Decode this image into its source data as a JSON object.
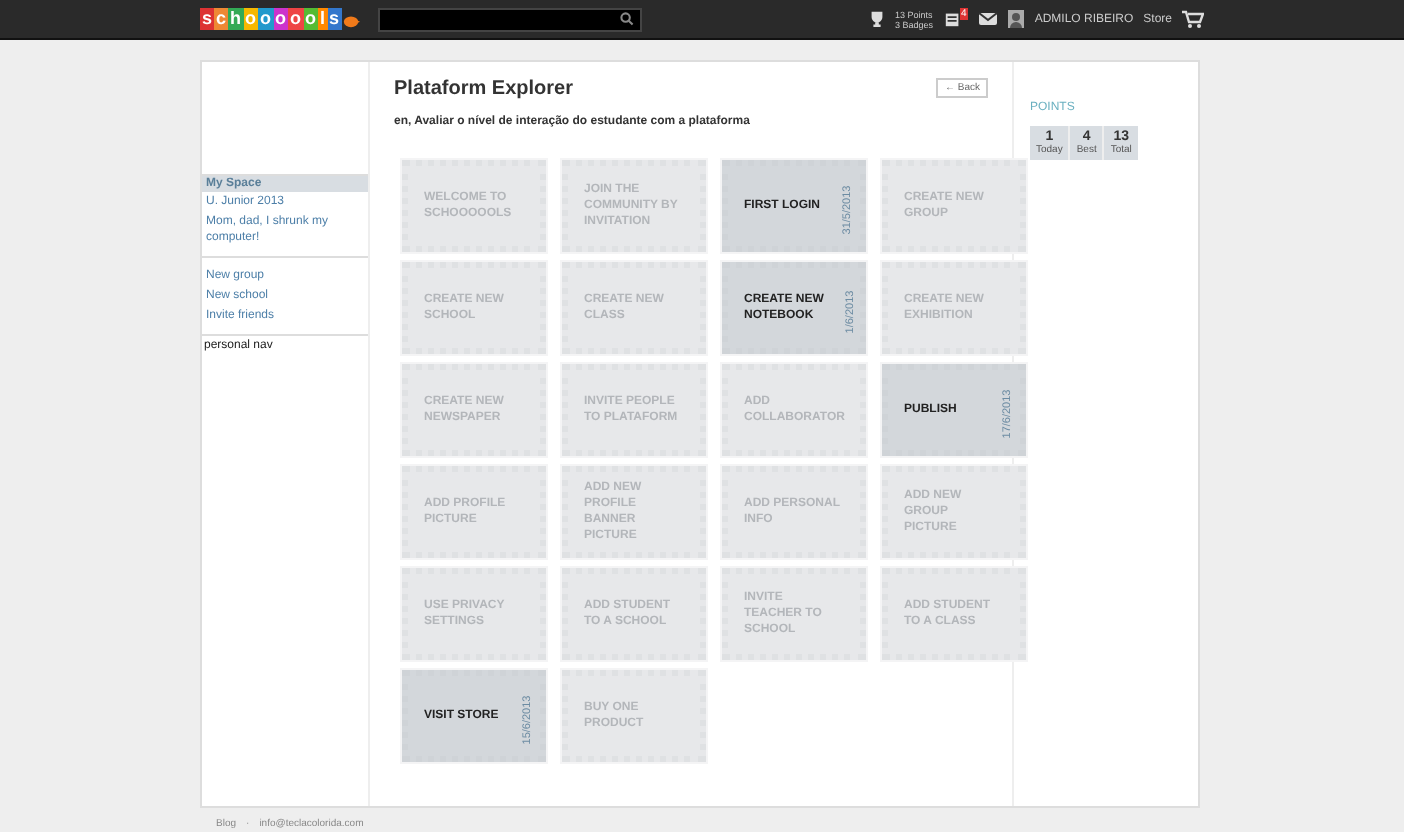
{
  "topbar": {
    "logo": "schoooools",
    "points": "13 Points",
    "badges": "3 Badges",
    "notifications": "4",
    "user": "ADMILO RIBEIRO",
    "store": "Store"
  },
  "sidebar": {
    "header": "My Space",
    "items": [
      "U. Junior 2013",
      "Mom, dad, I shrunk my computer!"
    ],
    "links": [
      "New group",
      "New school",
      "Invite friends"
    ],
    "note": "personal nav"
  },
  "main": {
    "title": "Plataform Explorer",
    "back": "← Back",
    "subtitle": "en, Avaliar o nível de interação do estudante com a plataforma",
    "badges": [
      {
        "label": "WELCOME TO SCHOOOOOLS",
        "earned": false
      },
      {
        "label": "JOIN THE COMMUNITY BY INVITATION",
        "earned": false
      },
      {
        "label": "FIRST LOGIN",
        "earned": true,
        "date": "31/5/2013"
      },
      {
        "label": "CREATE NEW GROUP",
        "earned": false
      },
      {
        "label": "CREATE NEW SCHOOL",
        "earned": false
      },
      {
        "label": "CREATE NEW CLASS",
        "earned": false
      },
      {
        "label": "CREATE NEW NOTEBOOK",
        "earned": true,
        "date": "1/6/2013"
      },
      {
        "label": "CREATE NEW EXHIBITION",
        "earned": false
      },
      {
        "label": "CREATE NEW NEWSPAPER",
        "earned": false
      },
      {
        "label": "INVITE PEOPLE TO PLATAFORM",
        "earned": false
      },
      {
        "label": "ADD COLLABORATOR",
        "earned": false
      },
      {
        "label": "PUBLISH",
        "earned": true,
        "date": "17/6/2013"
      },
      {
        "label": "ADD PROFILE PICTURE",
        "earned": false
      },
      {
        "label": "ADD NEW PROFILE BANNER PICTURE",
        "earned": false
      },
      {
        "label": "ADD PERSONAL INFO",
        "earned": false
      },
      {
        "label": "ADD NEW GROUP PICTURE",
        "earned": false
      },
      {
        "label": "USE PRIVACY SETTINGS",
        "earned": false
      },
      {
        "label": "ADD STUDENT TO A SCHOOL",
        "earned": false
      },
      {
        "label": "INVITE TEACHER TO SCHOOL",
        "earned": false
      },
      {
        "label": "ADD STUDENT TO A CLASS",
        "earned": false
      },
      {
        "label": "VISIT STORE",
        "earned": true,
        "date": "15/6/2013"
      },
      {
        "label": "BUY ONE PRODUCT",
        "earned": false
      }
    ]
  },
  "points": {
    "title": "POINTS",
    "stats": [
      {
        "value": "1",
        "label": "Today"
      },
      {
        "value": "4",
        "label": "Best"
      },
      {
        "value": "13",
        "label": "Total"
      }
    ]
  },
  "footer": {
    "links": [
      "Blog",
      "info@teclacolorida.com"
    ],
    "separator": "·"
  }
}
